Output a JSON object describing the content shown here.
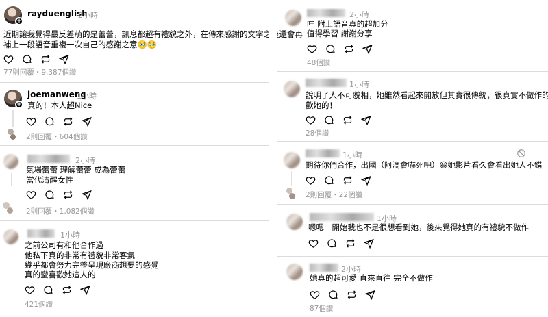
{
  "left": {
    "post1": {
      "username": "rayduenglish",
      "time": "2小時",
      "lines": [
        "近期讓我覺得最反差萌的是蕾蕾，訊息都超有禮貌之外，在傳來感謝的文字之後還會再",
        "補上一段語音重複一次自己的感謝之意🥹🥹"
      ],
      "meta": "77則回覆・9,387個讚"
    },
    "post2": {
      "username": "joemanweng",
      "time": "1小時",
      "lines": [
        "真的！本人超Nice"
      ],
      "meta": "2則回覆・604個讚"
    },
    "post3": {
      "time": "2小時",
      "lines": [
        "氣場蕾蕾 理解蕾蕾 成為蕾蕾",
        "當代清醒女性"
      ],
      "meta": "2則回覆・1,082個讚"
    },
    "post4": {
      "time": "1小時",
      "lines": [
        "之前公司有和他合作過",
        "他私下真的非常有禮貌非常客氣",
        "幾乎都會努力完整呈現廠商想要的感覺",
        "真的蠻喜歡她這人的"
      ],
      "meta": "421個讚"
    }
  },
  "right": {
    "post1": {
      "time": "2小時",
      "lines": [
        "哇 附上語音真的超加分",
        "值得學習 謝謝分享"
      ],
      "meta": "48個讚"
    },
    "post2": {
      "time": "1小時",
      "lines": [
        "說明了人不可貌相，她雖然看起來開放但其實很傳統，很真實不做作的人超喜",
        "歡她的！"
      ],
      "meta": "28個讚"
    },
    "post3": {
      "time": "1小時",
      "lines": [
        "期待你們合作，出國（阿滴會嚇死吧）😆她影片看久會看出她人不錯"
      ],
      "meta": "2則回覆・22個讚"
    },
    "post4": {
      "time": "1小時",
      "lines": [
        "嗯嗯一開始我也不是很想看到她，後來覺得她真的有禮貌不做作"
      ],
      "meta": ""
    },
    "post5": {
      "time": "2小時",
      "lines": [
        "她真的超可愛 直來直往 完全不做作"
      ],
      "meta": "87個讚"
    }
  },
  "icons": {
    "like": "heart-icon",
    "comment": "comment-icon",
    "repost": "repost-icon",
    "share": "share-icon"
  },
  "colors": {
    "secondary_text": "#999999",
    "divider": "#dbdbdb"
  }
}
